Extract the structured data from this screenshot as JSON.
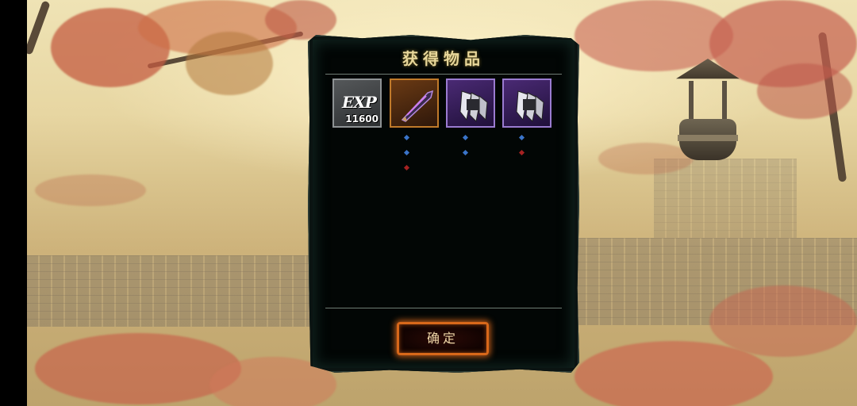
{
  "dialog": {
    "title": "获得物品",
    "confirm_label": "确定"
  },
  "items": [
    {
      "type": "exp",
      "icon": "exp-icon",
      "label": "EXP",
      "value": "11600",
      "frame_color": "#8e9294"
    },
    {
      "type": "equipment",
      "icon": "purple-blade-icon",
      "frame_color": "#c07a2a",
      "gems": [
        "blue",
        "blue",
        "red"
      ]
    },
    {
      "type": "equipment",
      "icon": "claw-blade-icon",
      "frame_color": "#9a7bd0",
      "gems": [
        "blue",
        "blue"
      ]
    },
    {
      "type": "equipment",
      "icon": "claw-blade-icon",
      "frame_color": "#9a7bd0",
      "gems": [
        "blue",
        "red"
      ]
    }
  ],
  "colors": {
    "title": "#e8d79a",
    "button_border": "#d8681a",
    "panel_bg": "#020605"
  }
}
